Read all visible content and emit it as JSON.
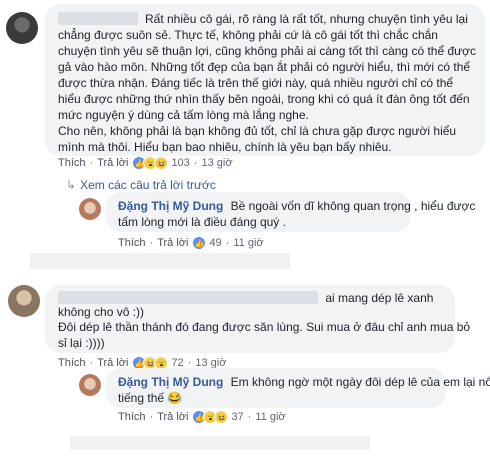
{
  "comment1": {
    "lines": [
      "Rất nhiều cô gái, rõ ràng là rất tốt, nhưng chuyện tình yêu lại",
      "chẳng được suôn sẻ. Thực tế, không phải cứ là cô gái tốt thì chắc chắn",
      "chuyện tình yêu sẽ thuận lợi, cũng không phải ai càng tốt thì càng có thể được",
      "gả vào hào môn. Những tốt đẹp của bạn ắt phải có người hiểu, thì mới có thể",
      "được thừa nhận. Đáng tiếc là trên thế giới này, quá nhiều người chỉ có thể",
      "hiểu được những thứ nhìn thấy bên ngoài, trong khi có quá ít đàn ông tốt đến",
      "mức nguyện ý dùng cả tấm lòng mà lắng nghe.",
      "Cho nên, không phải là bạn không đủ tốt, chỉ là chưa gặp được người hiểu",
      "mình mà thôi. Hiểu bạn bao nhiêu, chính là yêu bạn bấy nhiêu."
    ],
    "like": "Thích",
    "reply": "Trả lời",
    "count": "103",
    "time": "13 giờ"
  },
  "view_replies": "Xem các câu trả lời trước",
  "reply1": {
    "name": "Đặng Thị Mỹ Dung",
    "text_line1": "Bề ngoài vốn dĩ không quan trọng , hiểu được",
    "text_line2": "tấm lòng mới là điều đáng quý .",
    "like": "Thích",
    "reply": "Trả lời",
    "count": "49",
    "time": "11 giờ"
  },
  "comment2": {
    "line1_end": "ai mang dép lê xanh",
    "line2": "không cho vô :))",
    "line3": "Đôi dép lê thần thánh đó đang được săn lùng. Sui mua ở đâu chỉ anh mua bỏ",
    "line4": "sỉ lại :))))",
    "like": "Thích",
    "reply": "Trả lời",
    "count": "72",
    "time": "13 giờ"
  },
  "reply2": {
    "name": "Đặng Thị Mỹ Dung",
    "text_line1": "Em không ngờ một ngày đôi dép lê của em lại nổi",
    "text_line2": "tiếng thế 😂",
    "like": "Thích",
    "reply": "Trả lời",
    "count": "37",
    "time": "11 giờ"
  },
  "colors": {
    "link": "#385898",
    "bubble": "#f2f3f5",
    "meta": "#606770"
  }
}
